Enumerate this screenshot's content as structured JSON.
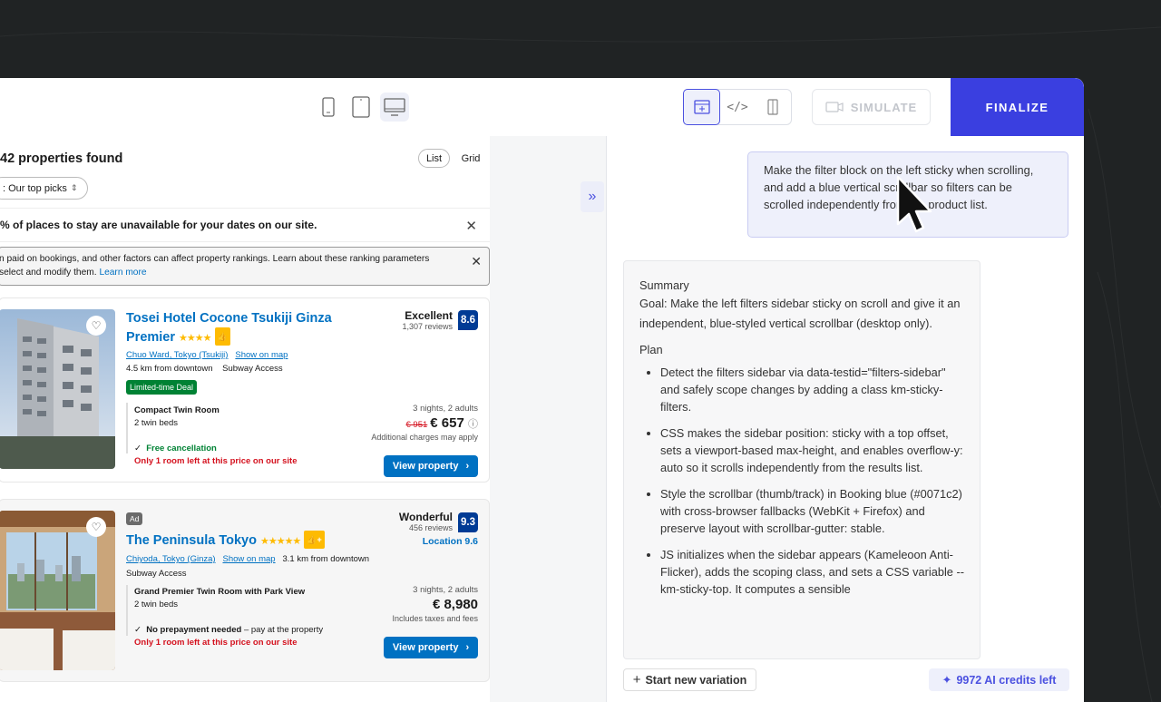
{
  "toolbar": {
    "simulate_label": "SIMULATE",
    "finalize_label": "FINALIZE"
  },
  "preview": {
    "found": "42 properties found",
    "toggle_list": "List",
    "toggle_grid": "Grid",
    "sort_label": ": Our top picks",
    "notice_unavailable": "% of places to stay are unavailable for your dates on our site.",
    "notice_ranking_line1": "n paid on bookings, and other factors can affect property rankings. Learn about these ranking parameters",
    "notice_ranking_line2": "select and modify them.",
    "learn_more": "Learn more",
    "cards": [
      {
        "name_line1": "Tosei Hotel Cocone Tsukiji Ginza",
        "name_line2": "Premier",
        "stars": "★★★★",
        "badge": "👍",
        "location": "Chuo Ward, Tokyo (Tsukiji)",
        "show_map": "Show on map",
        "distance": "4.5 km from downtown",
        "access": "Subway Access",
        "deal": "Limited-time Deal",
        "room": "Compact Twin Room",
        "beds": "2 twin beds",
        "perk": "Free cancellation",
        "scarcity": "Only 1 room left at this price on our site",
        "score_word": "Excellent",
        "reviews": "1,307 reviews",
        "score": "8.6",
        "nights": "3 nights, 2 adults",
        "old_price": "€ 951",
        "price": "€ 657",
        "charges": "Additional charges may apply",
        "button": "View property"
      },
      {
        "ad": "Ad",
        "name_line1": "The Peninsula Tokyo",
        "stars": "★★★★★",
        "badge": "👍+",
        "location": "Chiyoda, Tokyo (Ginza)",
        "show_map": "Show on map",
        "distance": "3.1 km from downtown",
        "access": "Subway Access",
        "room": "Grand Premier Twin Room with Park View",
        "beds": "2 twin beds",
        "perk": "No prepayment needed",
        "perk_suffix": " – pay at the property",
        "scarcity": "Only 1 room left at this price on our site",
        "score_word": "Wonderful",
        "reviews": "456 reviews",
        "score": "9.3",
        "location_score": "Location 9.6",
        "nights": "3 nights, 2 adults",
        "price": "€ 8,980",
        "charges": "Includes taxes and fees",
        "button": "View property"
      }
    ]
  },
  "chat": {
    "user_message": "Make the filter block on the left sticky when scrolling, and add a blue vertical scrollbar so filters can be scrolled independently from the product list.",
    "summary_title": "Summary",
    "goal": "Goal: Make the left filters sidebar sticky on scroll and give it an independent, blue-styled vertical scrollbar (desktop only).",
    "plan_title": "Plan",
    "plan": [
      "Detect the filters sidebar via data-testid=\"filters-sidebar\" and safely scope changes by adding a class km-sticky-filters.",
      "CSS makes the sidebar position: sticky with a top offset, sets a viewport-based max-height, and enables overflow-y: auto so it scrolls independently from the results list.",
      "Style the scrollbar (thumb/track) in Booking blue (#0071c2) with cross-browser fallbacks (WebKit + Firefox) and preserve layout with scrollbar-gutter: stable.",
      "JS initializes when the sidebar appears (Kameleoon Anti-Flicker), adds the scoping class, and sets a CSS variable --km-sticky-top. It computes a sensible"
    ],
    "new_variation": "Start new variation",
    "credits": "9972 AI credits left"
  },
  "colors": {
    "accent": "#3a3fe0",
    "booking_blue": "#0071c2",
    "score_blue": "#003b95",
    "deal_green": "#008234",
    "alert_red": "#d4111e"
  }
}
